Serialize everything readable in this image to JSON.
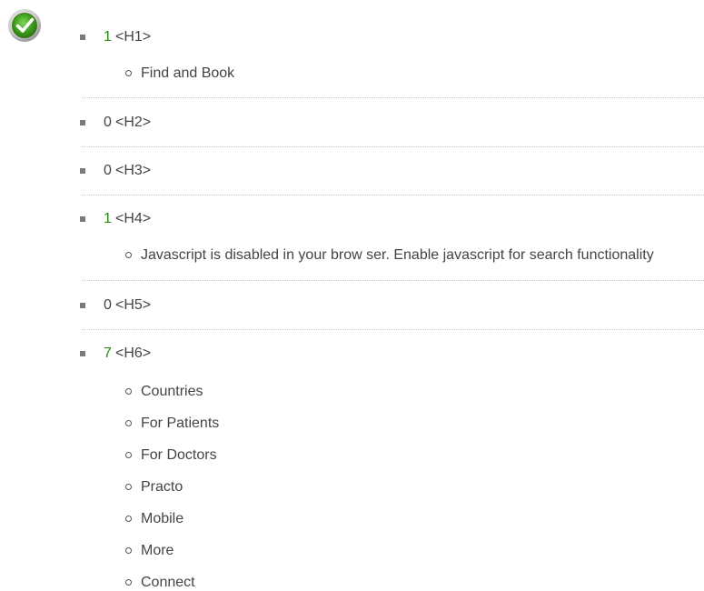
{
  "icons": {
    "status": "check-icon",
    "status_color": "#3fa01c"
  },
  "headings": [
    {
      "count": "1",
      "tag": "<H1>",
      "items": [
        "Find and Book"
      ]
    },
    {
      "count": "0",
      "tag": "<H2>",
      "items": []
    },
    {
      "count": "0",
      "tag": "<H3>",
      "items": []
    },
    {
      "count": "1",
      "tag": "<H4>",
      "items": [
        "Javascript is disabled in your brow ser. Enable javascript for search functionality"
      ]
    },
    {
      "count": "0",
      "tag": "<H5>",
      "items": []
    },
    {
      "count": "7",
      "tag": "<H6>",
      "items": [
        "Countries",
        "For Patients",
        "For Doctors",
        "Practo",
        "Mobile",
        "More",
        "Connect"
      ]
    }
  ]
}
